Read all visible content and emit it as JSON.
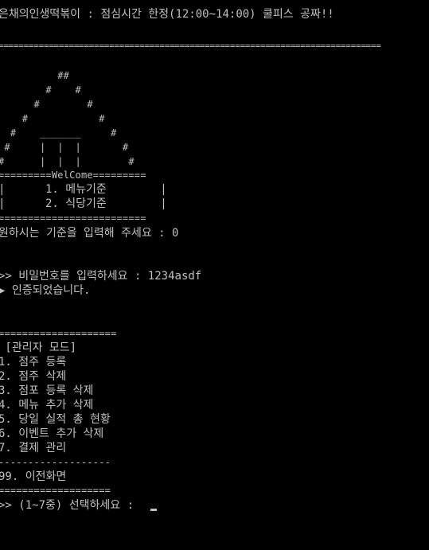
{
  "window": {
    "content": "console-output"
  },
  "console": {
    "lines": {
      "header": "은채의인생떡볶이 : 점심시간 한정(12:00~14:00) 쿨피스 공짜!!",
      "header_rule": "============================================================================",
      "art_1": "          ##",
      "art_2": "        #    #",
      "art_3": "      #        #",
      "art_4": "    #            #",
      "art_5": "  #    _______     #",
      "art_6": " #     |  |  |       #",
      "art_7": "#      |  |  |        #",
      "welcome": "=========WelCome=========",
      "menu_1": "|      1. 메뉴기준        |",
      "menu_2": "|      2. 식당기준        |",
      "menu_rule": "=========================",
      "choose_criteria": "원하시는 기준을 입력해 주세요 : 0",
      "password_prompt": ">> 비밀번호를 입력하세요 : 1234asdf",
      "auth_ok": "▶ 인증되었습니다.",
      "admin_rule_top": "====================",
      "admin_title": " [관리자 모드]",
      "opt_1": "1. 점주 등록",
      "opt_2": "2. 점주 삭제",
      "opt_3": "3. 점포 등록 삭제",
      "opt_4": "4. 메뉴 추가 삭제",
      "opt_5": "5. 당일 실적 총 현황",
      "opt_6": "6. 이벤트 추가 삭제",
      "opt_7": "7. 결제 관리",
      "dash_rule": "-------------------",
      "opt_99": "99. 이전화면",
      "admin_rule_bottom": "===================",
      "select_prompt": ">> (1~7중) 선택하세요 : "
    }
  },
  "colors": {
    "background": "#000000",
    "text": "#c0c0c0"
  }
}
